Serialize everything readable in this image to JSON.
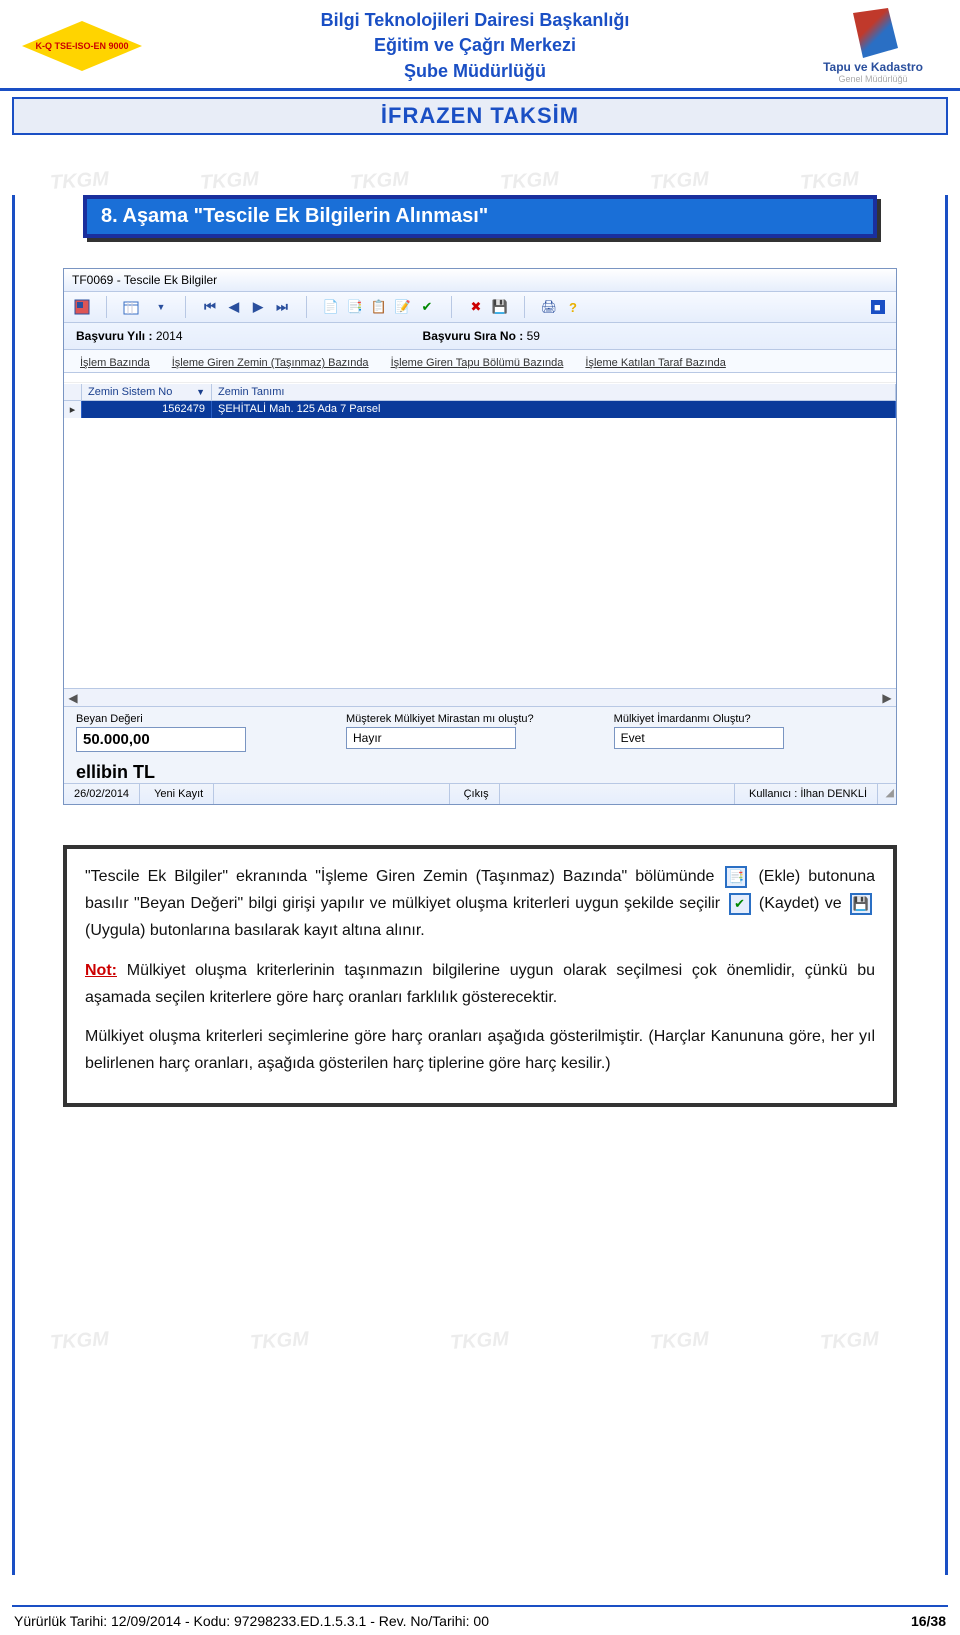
{
  "header": {
    "left_logo_text": "K-Q TSE-ISO-EN 9000",
    "line1": "Bilgi Teknolojileri Dairesi Başkanlığı",
    "line2": "Eğitim ve Çağrı Merkezi",
    "line3": "Şube Müdürlüğü",
    "right_title": "Tapu ve Kadastro",
    "right_sub": "Genel Müdürlüğü"
  },
  "doc_title": "İFRAZEN TAKSİM",
  "stage_title": "8. Aşama \"Tescile Ek Bilgilerin Alınması\"",
  "app": {
    "window_title": "TF0069 - Tescile Ek Bilgiler",
    "yil_label": "Başvuru Yılı :",
    "yil_value": "2014",
    "sira_label": "Başvuru Sıra No :",
    "sira_value": "59",
    "tabs": {
      "t1": "İşlem Bazında",
      "t2": "İşleme Giren Zemin (Taşınmaz) Bazında",
      "t3": "İşleme Giren Tapu Bölümü Bazında",
      "t4": "İşleme Katılan Taraf Bazında"
    },
    "grid": {
      "col1": "Zemin Sistem No",
      "col2": "Zemin Tanımı",
      "row1_sys": "1562479",
      "row1_def": "ŞEHİTALİ Mah. 125 Ada 7 Parsel"
    },
    "bottom": {
      "beyan_label": "Beyan Değeri",
      "beyan_value": "50.000,00",
      "beyan_text": "ellibin TL",
      "musterek_label": "Müşterek Mülkiyet Mirastan mı oluştu?",
      "musterek_value": "Hayır",
      "imar_label": "Mülkiyet İmardanmı Oluştu?",
      "imar_value": "Evet"
    },
    "status": {
      "date": "26/02/2014",
      "mode": "Yeni Kayıt",
      "exit": "Çıkış",
      "user_label": "Kullanıcı :",
      "user": "İlhan DENKLİ"
    }
  },
  "instr": {
    "p1_a": "\"Tescile Ek Bilgiler\" ekranında \"İşleme Giren Zemin (Taşınmaz) Bazında\" bölümünde",
    "p1_b": "(Ekle) butonuna basılır  \"Beyan Değeri\" bilgi girişi yapılır ve mülkiyet oluşma kriterleri uygun şekilde seçilir",
    "p1_c": "(Kaydet) ve",
    "p1_d": "(Uygula) butonlarına basılarak kayıt altına alınır.",
    "note_label": "Not:",
    "p2": "Mülkiyet oluşma kriterlerinin taşınmazın bilgilerine uygun olarak seçilmesi çok önemlidir, çünkü bu aşamada seçilen kriterlere göre harç oranları farklılık gösterecektir.",
    "p3": "Mülkiyet oluşma kriterleri seçimlerine göre harç oranları aşağıda gösterilmiştir. (Harçlar Kanununa göre, her yıl belirlenen harç oranları, aşağıda gösterilen harç tiplerine göre harç kesilir.)"
  },
  "footer": {
    "left": "Yürürlük Tarihi: 12/09/2014 - Kodu: 97298233.ED.1.5.3.1 - Rev. No/Tarihi: 00",
    "right": "16/38"
  },
  "wm": "TKGM"
}
